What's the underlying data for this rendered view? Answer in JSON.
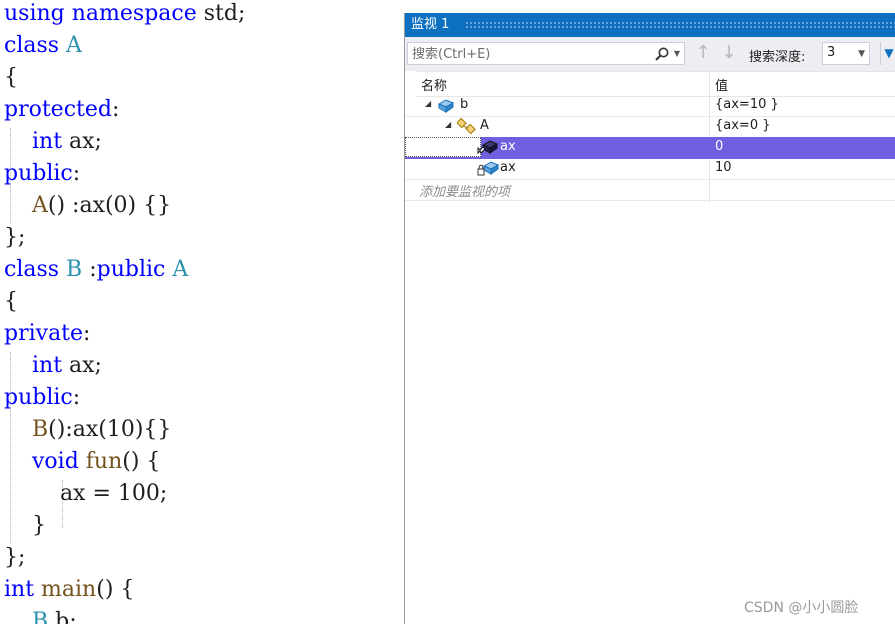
{
  "code": {
    "lines": [
      [
        {
          "t": "using namespace",
          "c": "kw"
        },
        {
          "t": " std;",
          "c": ""
        }
      ],
      [
        {
          "t": "class ",
          "c": "kw"
        },
        {
          "t": "A",
          "c": "ty"
        }
      ],
      [
        {
          "t": "{",
          "c": ""
        }
      ],
      [
        {
          "t": "protected",
          "c": "kw"
        },
        {
          "t": ":",
          "c": ""
        }
      ],
      [
        {
          "t": "    ",
          "c": ""
        },
        {
          "t": "int",
          "c": "kw"
        },
        {
          "t": " ax;",
          "c": ""
        }
      ],
      [
        {
          "t": "public",
          "c": "kw"
        },
        {
          "t": ":",
          "c": ""
        }
      ],
      [
        {
          "t": "    ",
          "c": ""
        },
        {
          "t": "A",
          "c": "fn"
        },
        {
          "t": "() :ax(0) {}",
          "c": ""
        }
      ],
      [
        {
          "t": "};",
          "c": ""
        }
      ],
      [
        {
          "t": "class ",
          "c": "kw"
        },
        {
          "t": "B",
          "c": "ty"
        },
        {
          "t": " :",
          "c": ""
        },
        {
          "t": "public ",
          "c": "kw"
        },
        {
          "t": "A",
          "c": "ty"
        }
      ],
      [
        {
          "t": "{",
          "c": ""
        }
      ],
      [
        {
          "t": "private",
          "c": "kw"
        },
        {
          "t": ":",
          "c": ""
        }
      ],
      [
        {
          "t": "    ",
          "c": ""
        },
        {
          "t": "int",
          "c": "kw"
        },
        {
          "t": " ax;",
          "c": ""
        }
      ],
      [
        {
          "t": "public",
          "c": "kw"
        },
        {
          "t": ":",
          "c": ""
        }
      ],
      [
        {
          "t": "    ",
          "c": ""
        },
        {
          "t": "B",
          "c": "fn"
        },
        {
          "t": "():ax(10){}",
          "c": ""
        }
      ],
      [
        {
          "t": "    ",
          "c": ""
        },
        {
          "t": "void ",
          "c": "kw"
        },
        {
          "t": "fun",
          "c": "fn"
        },
        {
          "t": "() {",
          "c": ""
        }
      ],
      [
        {
          "t": "        ax = 100;",
          "c": ""
        }
      ],
      [
        {
          "t": "    }",
          "c": ""
        }
      ],
      [
        {
          "t": "};",
          "c": ""
        }
      ],
      [
        {
          "t": "int ",
          "c": "kw"
        },
        {
          "t": "main",
          "c": "fn"
        },
        {
          "t": "() {",
          "c": ""
        }
      ],
      [
        {
          "t": "    ",
          "c": ""
        },
        {
          "t": "B",
          "c": "ty"
        },
        {
          "t": " b;",
          "c": ""
        }
      ]
    ]
  },
  "watch": {
    "title": "监视 1",
    "search_placeholder": "搜索(Ctrl+E)",
    "depth_label": "搜索深度:",
    "depth_value": "3",
    "columns": {
      "name": "名称",
      "value": "值"
    },
    "rows": [
      {
        "name": "b",
        "value": "{ax=10 }",
        "indent": 0,
        "expander": "◢",
        "icon": "object-icon",
        "selected": false
      },
      {
        "name": "A",
        "value": "{ax=0 }",
        "indent": 1,
        "expander": "◢",
        "icon": "base-class-icon",
        "selected": false
      },
      {
        "name": "ax",
        "value": "0",
        "indent": 2,
        "expander": "",
        "icon": "protected-field-icon",
        "selected": true
      },
      {
        "name": "ax",
        "value": "10",
        "indent": 2,
        "expander": "",
        "icon": "private-field-icon",
        "selected": false
      }
    ],
    "add_watch": "添加要监视的项"
  },
  "watermark": "CSDN @小小圆脸",
  "colors": {
    "keyword": "#0000ff",
    "type": "#2b91af",
    "function": "#74531f",
    "title_bar": "#0e70c0",
    "selection": "#7060e0"
  }
}
